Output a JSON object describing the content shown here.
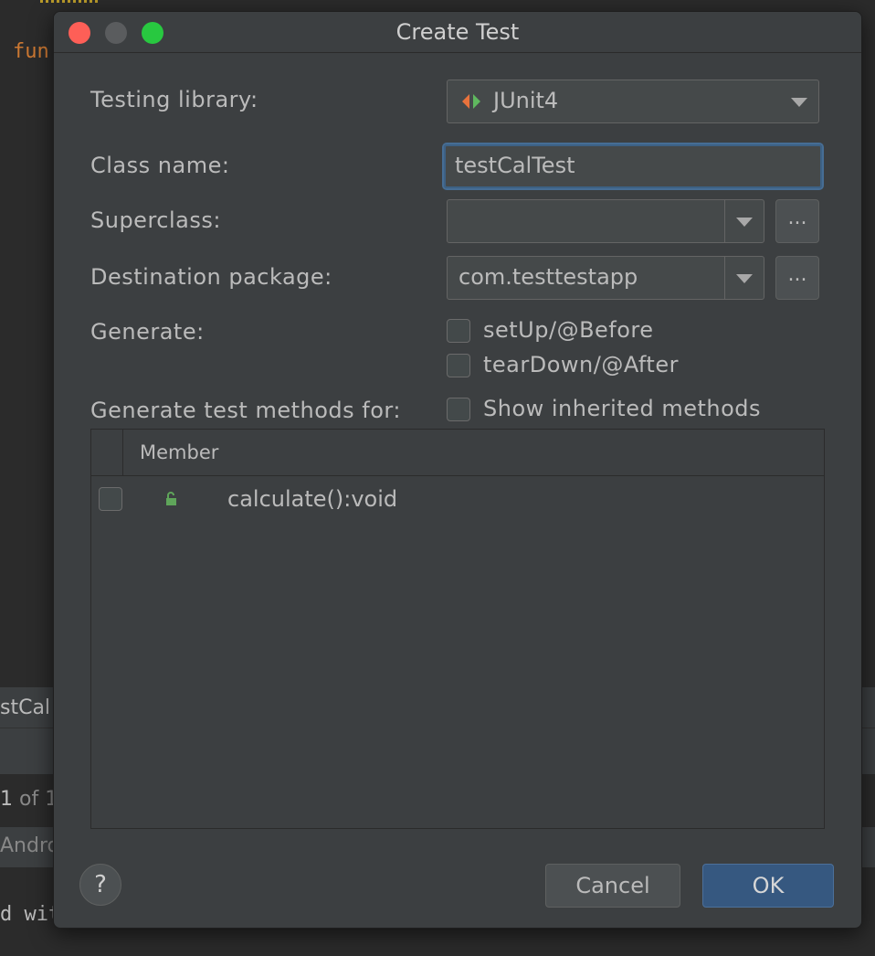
{
  "background": {
    "code_keyword": "fun",
    "tab_label": "stCal",
    "search_count": {
      "current": "1",
      "of": "of 1"
    },
    "android_label": "Andro",
    "log_text": "d wit"
  },
  "dialog": {
    "title": "Create Test",
    "testing_library": {
      "label": "Testing library:",
      "value": "JUnit4",
      "icon": "junit-icon"
    },
    "class_name": {
      "label": "Class name:",
      "value": "testCalTest"
    },
    "superclass": {
      "label": "Superclass:",
      "value": "",
      "browse": "..."
    },
    "destination_package": {
      "label": "Destination package:",
      "value": "com.testtestapp",
      "browse": "..."
    },
    "generate": {
      "label": "Generate:",
      "options": [
        {
          "label": "setUp/@Before",
          "checked": false
        },
        {
          "label": "tearDown/@After",
          "checked": false
        }
      ]
    },
    "methods": {
      "label": "Generate test methods for:",
      "show_inherited": {
        "label": "Show inherited methods",
        "checked": false
      },
      "column_header": "Member",
      "rows": [
        {
          "name": "calculate():void",
          "checked": false,
          "icon": "public-method-icon"
        }
      ]
    },
    "buttons": {
      "help": "?",
      "cancel": "Cancel",
      "ok": "OK"
    },
    "colors": {
      "accent": "#365880",
      "focus": "#466d94",
      "junit_orange": "#e8723c",
      "junit_green": "#5fb85f"
    }
  }
}
